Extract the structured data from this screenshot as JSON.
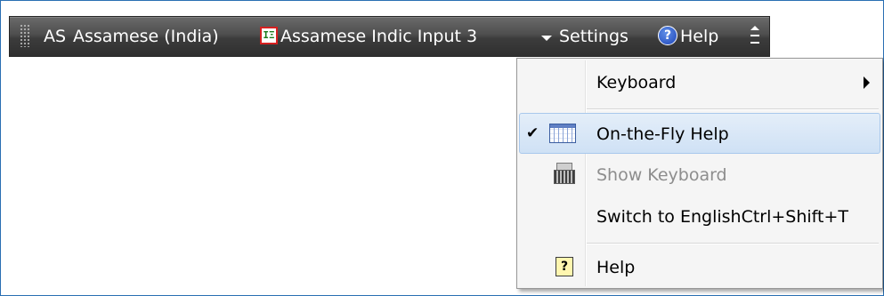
{
  "language_bar": {
    "language_code": "AS",
    "language_name": "Assamese (India)",
    "input_method": "Assamese Indic Input 3",
    "input_method_icon_text": "IΞ",
    "settings_label": "Settings",
    "help_label": "Help",
    "help_icon_glyph": "?"
  },
  "menu": {
    "items": [
      {
        "label": "Keyboard",
        "has_submenu": true
      },
      {
        "label": "On-the-Fly Help",
        "checked": true,
        "check_glyph": "✔",
        "icon": "grid-icon",
        "highlighted": true
      },
      {
        "label": "Show Keyboard",
        "disabled": true,
        "icon": "keyboard-icon"
      },
      {
        "label": "Switch to EnglishCtrl+Shift+T"
      },
      {
        "label": "Help",
        "icon": "help-icon",
        "icon_glyph": "?"
      }
    ]
  },
  "colors": {
    "highlight": "#cfe1f5",
    "frame_border": "#2a6fb3",
    "ime_icon_border": "#d62020"
  }
}
